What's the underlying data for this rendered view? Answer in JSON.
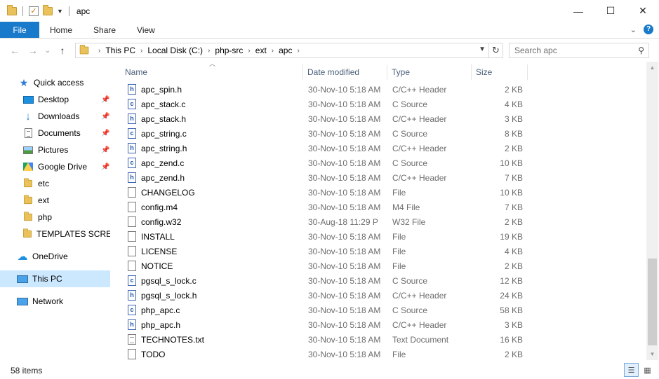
{
  "window": {
    "title": "apc",
    "controls": {
      "minimize": "—",
      "maximize": "☐",
      "close": "✕"
    }
  },
  "ribbon": {
    "tabs": [
      "File",
      "Home",
      "Share",
      "View"
    ],
    "expand_glyph": "⌄",
    "help_glyph": "?"
  },
  "nav": {
    "back": "←",
    "forward": "→",
    "recent": "⌄",
    "up": "↑",
    "breadcrumb": [
      "This PC",
      "Local Disk (C:)",
      "php-src",
      "ext",
      "apc"
    ],
    "refresh": "↻"
  },
  "search": {
    "placeholder": "Search apc"
  },
  "sidebar": {
    "quick_access": "Quick access",
    "pinned": [
      {
        "label": "Desktop",
        "icon": "desktop-icon"
      },
      {
        "label": "Downloads",
        "icon": "download-icon"
      },
      {
        "label": "Documents",
        "icon": "documents-icon"
      },
      {
        "label": "Pictures",
        "icon": "pictures-icon"
      },
      {
        "label": "Google Drive",
        "icon": "google-drive-icon"
      }
    ],
    "folders": [
      "etc",
      "ext",
      "php",
      "TEMPLATES SCREEN"
    ],
    "onedrive": "OneDrive",
    "this_pc": "This PC",
    "network": "Network"
  },
  "columns": {
    "name": "Name",
    "date": "Date modified",
    "type": "Type",
    "size": "Size"
  },
  "files": [
    {
      "name": "apc_spin.h",
      "date": "30-Nov-10 5:18 AM",
      "type": "C/C++ Header",
      "size": "2 KB",
      "icon": "h"
    },
    {
      "name": "apc_stack.c",
      "date": "30-Nov-10 5:18 AM",
      "type": "C Source",
      "size": "4 KB",
      "icon": "c"
    },
    {
      "name": "apc_stack.h",
      "date": "30-Nov-10 5:18 AM",
      "type": "C/C++ Header",
      "size": "3 KB",
      "icon": "h"
    },
    {
      "name": "apc_string.c",
      "date": "30-Nov-10 5:18 AM",
      "type": "C Source",
      "size": "8 KB",
      "icon": "c"
    },
    {
      "name": "apc_string.h",
      "date": "30-Nov-10 5:18 AM",
      "type": "C/C++ Header",
      "size": "2 KB",
      "icon": "h"
    },
    {
      "name": "apc_zend.c",
      "date": "30-Nov-10 5:18 AM",
      "type": "C Source",
      "size": "10 KB",
      "icon": "c"
    },
    {
      "name": "apc_zend.h",
      "date": "30-Nov-10 5:18 AM",
      "type": "C/C++ Header",
      "size": "7 KB",
      "icon": "h"
    },
    {
      "name": "CHANGELOG",
      "date": "30-Nov-10 5:18 AM",
      "type": "File",
      "size": "10 KB",
      "icon": "file"
    },
    {
      "name": "config.m4",
      "date": "30-Nov-10 5:18 AM",
      "type": "M4 File",
      "size": "7 KB",
      "icon": "file"
    },
    {
      "name": "config.w32",
      "date": "30-Aug-18 11:29 P",
      "type": "W32 File",
      "size": "2 KB",
      "icon": "file"
    },
    {
      "name": "INSTALL",
      "date": "30-Nov-10 5:18 AM",
      "type": "File",
      "size": "19 KB",
      "icon": "file"
    },
    {
      "name": "LICENSE",
      "date": "30-Nov-10 5:18 AM",
      "type": "File",
      "size": "4 KB",
      "icon": "file"
    },
    {
      "name": "NOTICE",
      "date": "30-Nov-10 5:18 AM",
      "type": "File",
      "size": "2 KB",
      "icon": "file"
    },
    {
      "name": "pgsql_s_lock.c",
      "date": "30-Nov-10 5:18 AM",
      "type": "C Source",
      "size": "12 KB",
      "icon": "c"
    },
    {
      "name": "pgsql_s_lock.h",
      "date": "30-Nov-10 5:18 AM",
      "type": "C/C++ Header",
      "size": "24 KB",
      "icon": "h"
    },
    {
      "name": "php_apc.c",
      "date": "30-Nov-10 5:18 AM",
      "type": "C Source",
      "size": "58 KB",
      "icon": "c"
    },
    {
      "name": "php_apc.h",
      "date": "30-Nov-10 5:18 AM",
      "type": "C/C++ Header",
      "size": "3 KB",
      "icon": "h"
    },
    {
      "name": "TECHNOTES.txt",
      "date": "30-Nov-10 5:18 AM",
      "type": "Text Document",
      "size": "16 KB",
      "icon": "txt"
    },
    {
      "name": "TODO",
      "date": "30-Nov-10 5:18 AM",
      "type": "File",
      "size": "2 KB",
      "icon": "file"
    }
  ],
  "status": {
    "item_count": "58 items"
  },
  "colors": {
    "accent": "#1979ca",
    "selection": "#cce8ff",
    "folder": "#e9c25c"
  }
}
